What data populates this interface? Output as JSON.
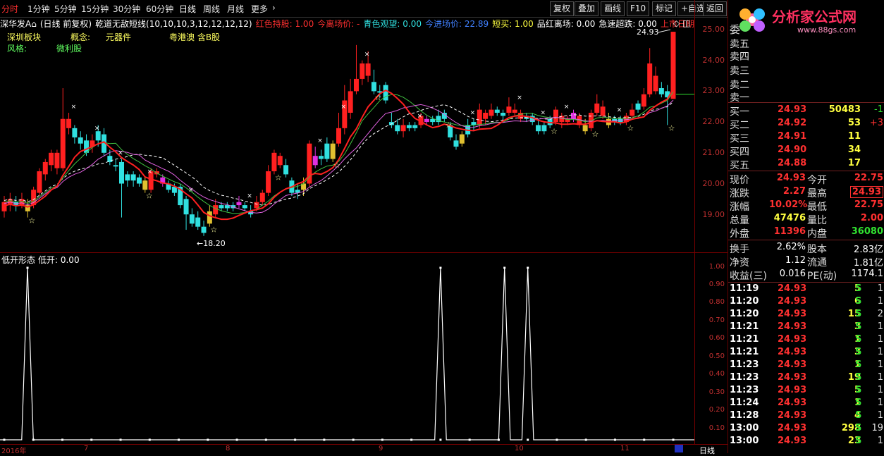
{
  "tabs": {
    "periods": [
      "分时",
      "1分钟",
      "5分钟",
      "15分钟",
      "30分钟",
      "60分钟",
      "日线",
      "周线",
      "月线",
      "更多"
    ],
    "active": "日线",
    "more_arrow": "›",
    "tools": [
      "复权",
      "叠加",
      "画线",
      "F10",
      "标记",
      "+自选",
      "返回"
    ]
  },
  "legend": {
    "stock": "深华发A",
    "period_info": "(日线 前复权)",
    "indicator": "乾道无敌短线(10,10,10,3,12,12,12,12)",
    "items": [
      {
        "label": "红色持股: 1.00",
        "color": "#ff3030"
      },
      {
        "label": "今离场价: -",
        "color": "#ff3030"
      },
      {
        "label": "青色观望: 0.00",
        "color": "#30e0e0"
      },
      {
        "label": "今进场价: 22.89",
        "color": "#4080ff"
      },
      {
        "label": "短买: 1.00",
        "color": "#ffff40"
      },
      {
        "label": "品红离场: 0.00",
        "color": "#ffffff"
      },
      {
        "label": "急速超跌: 0.00",
        "color": "#ffffff"
      },
      {
        "label": "上市日期年: 2",
        "color": "#ff3030"
      }
    ],
    "tags": {
      "sector_label": "深圳板块",
      "concept_label": "概念:",
      "concept_value": "元器件",
      "region": "粤港澳 含B股",
      "style_label": "风格:",
      "style_value": "微利股"
    },
    "icons": [
      "diamond-icon",
      "square-icon"
    ]
  },
  "main_chart": {
    "high_label": "24.93",
    "low_label": "18.20",
    "y_ticks": [
      "25.00",
      "24.00",
      "23.00",
      "22.00",
      "21.00",
      "20.00",
      "19.00"
    ]
  },
  "sub_chart": {
    "title": "低开形态",
    "value_label": "低开: 0.00",
    "y_ticks": [
      "1.00",
      "0.90",
      "0.80",
      "0.70",
      "0.60",
      "0.50",
      "0.40",
      "0.30",
      "0.20",
      "0.10"
    ]
  },
  "date_axis": {
    "labels": [
      "2016年",
      "7",
      "8",
      "9",
      "10",
      "11"
    ],
    "period_btn": "日线"
  },
  "chart_data": {
    "type": "table",
    "title": "",
    "subchart_spikes_bar_index": [
      4,
      66,
      75,
      79
    ],
    "ohlc_note": "candles estimated from the picture"
  },
  "logo": {
    "text": "分析家公式网",
    "url_text": "www.88gs.com"
  },
  "quote": {
    "labels": [
      "委",
      "卖五",
      "卖四",
      "卖三",
      "卖二",
      "卖一"
    ],
    "bids": [
      {
        "name": "买一",
        "price": "24.93",
        "vol": "50483",
        "chg": "-1"
      },
      {
        "name": "买二",
        "price": "24.92",
        "vol": "53",
        "chg": "+3"
      },
      {
        "name": "买三",
        "price": "24.91",
        "vol": "11",
        "chg": ""
      },
      {
        "name": "买四",
        "price": "24.90",
        "vol": "34",
        "chg": ""
      },
      {
        "name": "买五",
        "price": "24.88",
        "vol": "17",
        "chg": ""
      }
    ],
    "stats": [
      {
        "l1": "现价",
        "v1": "24.93",
        "l2": "今开",
        "v2": "22.75"
      },
      {
        "l1": "涨跌",
        "v1": "2.27",
        "l2": "最高",
        "v2": "24.93"
      },
      {
        "l1": "涨幅",
        "v1": "10.02%",
        "l2": "最低",
        "v2": "22.75"
      },
      {
        "l1": "总量",
        "v1": "47476",
        "l2": "量比",
        "v2": "2.00"
      },
      {
        "l1": "外盘",
        "v1": "11396",
        "l2": "内盘",
        "v2": "36080"
      }
    ],
    "fin": [
      {
        "l1": "换手",
        "v1": "2.62%",
        "l2": "股本",
        "v2": "2.83亿"
      },
      {
        "l1": "净资",
        "v1": "1.12",
        "l2": "流通",
        "v2": "1.81亿"
      },
      {
        "l1": "收益(三)",
        "v1": "0.016",
        "l2": "PE(动)",
        "v2": "1174.1"
      }
    ],
    "ticks": [
      {
        "t": "11:19",
        "p": "24.93",
        "v": "5",
        "s": "S",
        "x": "1"
      },
      {
        "t": "11:20",
        "p": "24.93",
        "v": "6",
        "s": "S",
        "x": "1"
      },
      {
        "t": "11:20",
        "p": "24.93",
        "v": "15",
        "s": "S",
        "x": "2"
      },
      {
        "t": "11:21",
        "p": "24.93",
        "v": "3",
        "s": "S",
        "x": "1"
      },
      {
        "t": "11:21",
        "p": "24.93",
        "v": "1",
        "s": "S",
        "x": "1"
      },
      {
        "t": "11:21",
        "p": "24.93",
        "v": "3",
        "s": "S",
        "x": "1"
      },
      {
        "t": "11:23",
        "p": "24.93",
        "v": "1",
        "s": "S",
        "x": "1"
      },
      {
        "t": "11:23",
        "p": "24.93",
        "v": "19",
        "s": "S",
        "x": "1"
      },
      {
        "t": "11:23",
        "p": "24.93",
        "v": "5",
        "s": "S",
        "x": "1"
      },
      {
        "t": "11:24",
        "p": "24.93",
        "v": "1",
        "s": "S",
        "x": "1"
      },
      {
        "t": "11:28",
        "p": "24.93",
        "v": "4",
        "s": "S",
        "x": "1"
      },
      {
        "t": "13:00",
        "p": "24.93",
        "v": "298",
        "s": "S",
        "x": "19"
      },
      {
        "t": "13:00",
        "p": "24.93",
        "v": "23",
        "s": "S",
        "x": "1"
      },
      {
        "t": "13:00",
        "p": "24.93",
        "v": "",
        "s": "",
        "x": ""
      }
    ]
  },
  "colors": {
    "up": "#ff2020",
    "down": "#30e0e0",
    "yellow": "#e0c030",
    "magenta": "#e030e0",
    "ma_red": "#ff2020",
    "ma_pink": "#e060e0",
    "ma_white": "#ffffff",
    "ma_green": "#40c040"
  }
}
